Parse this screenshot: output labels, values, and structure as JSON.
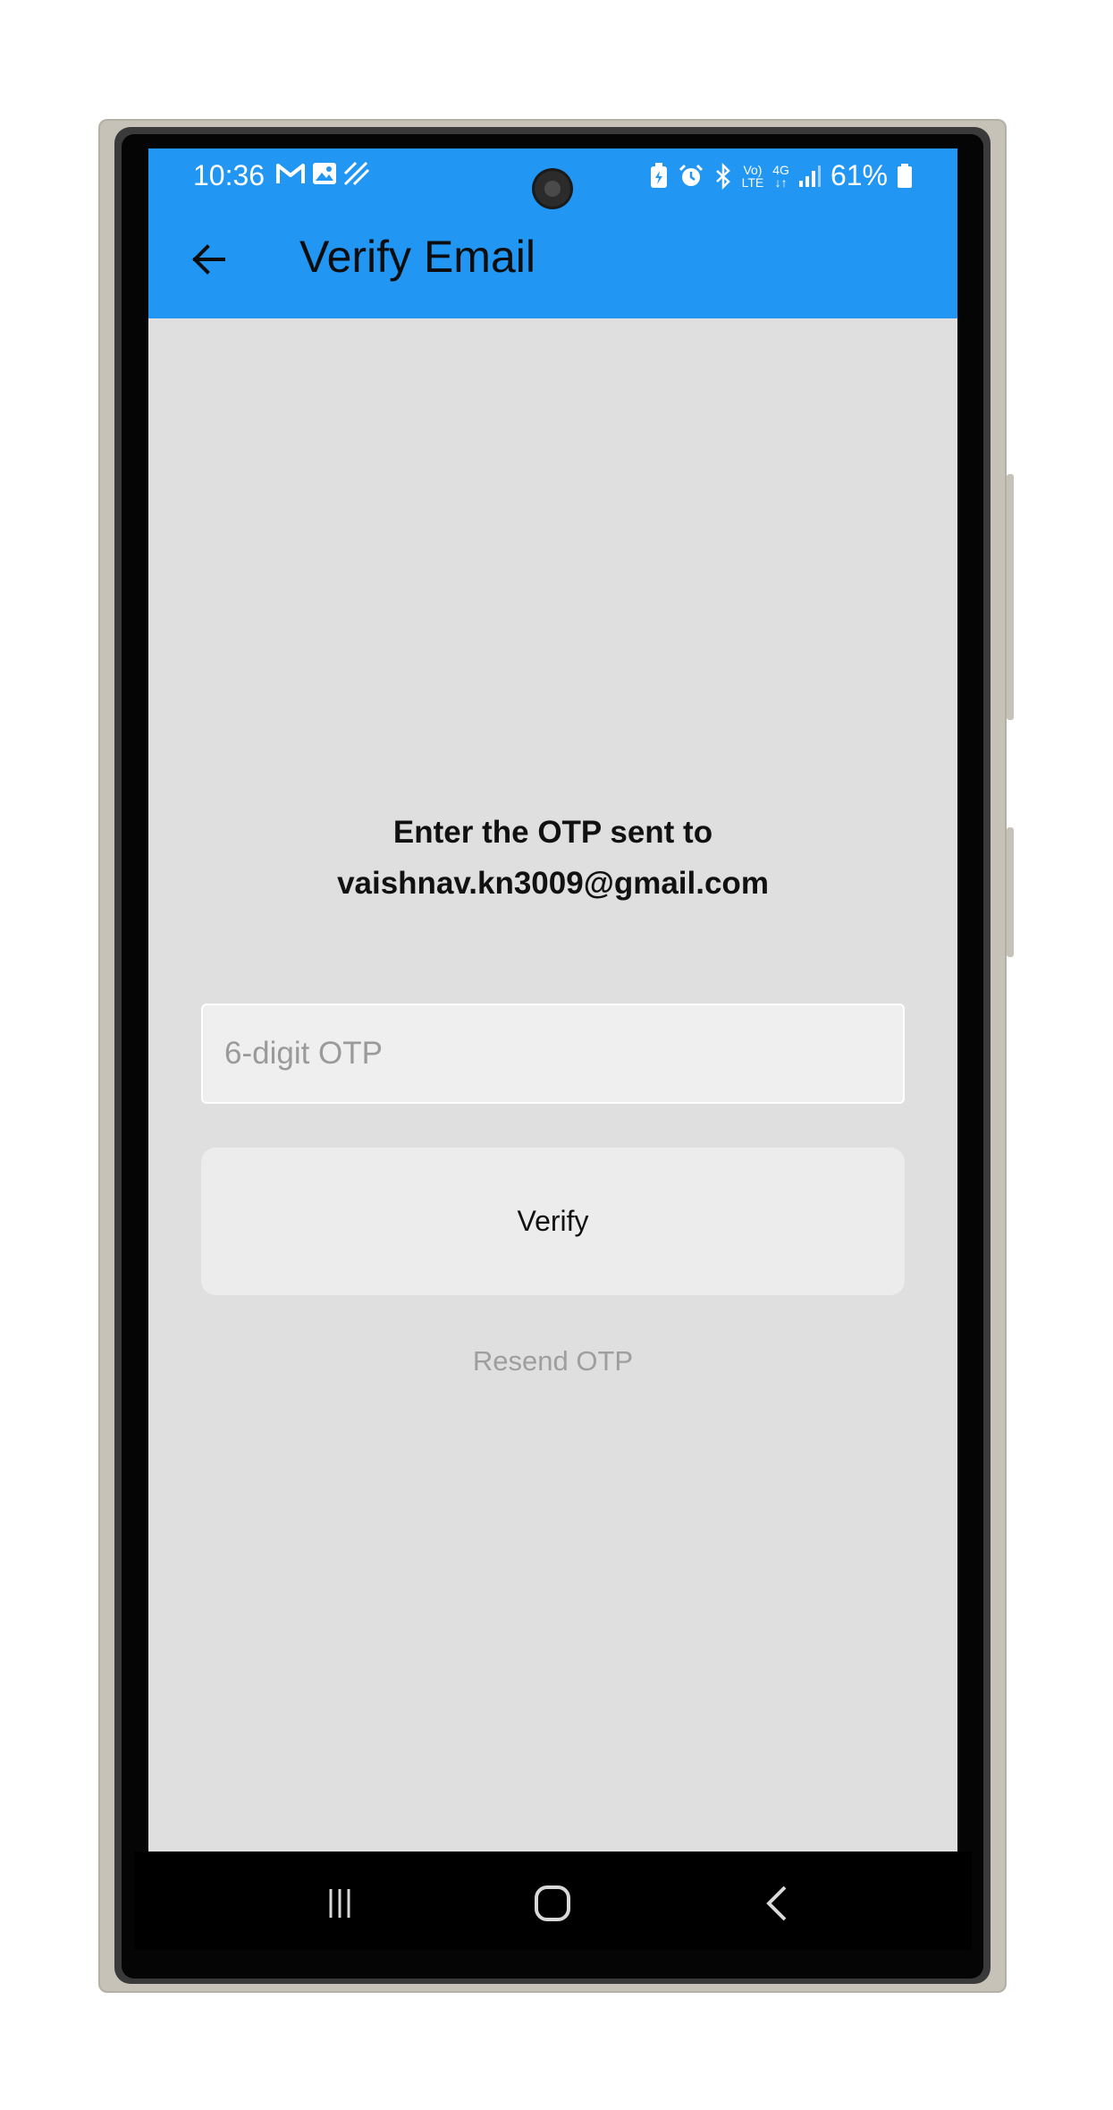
{
  "status_bar": {
    "time": "10:36",
    "battery": "61%",
    "left_icons": [
      "gmail-icon",
      "gallery-icon",
      "sync-stripes-icon"
    ],
    "right_icons": [
      "battery-saver-icon",
      "alarm-icon",
      "bluetooth-icon",
      "volte-icon",
      "4g-icon",
      "signal-icon",
      "battery-icon"
    ],
    "volte_top": "Vo)",
    "volte_bottom": "LTE",
    "net_top": "4G",
    "net_bottom": "↓↑"
  },
  "app_bar": {
    "title": "Verify Email",
    "back_icon": "back-arrow-icon",
    "color": "#2196f3"
  },
  "main": {
    "prompt_line1": "Enter the OTP sent to",
    "prompt_line2": "vaishnav.kn3009@gmail.com",
    "otp_placeholder": "6-digit OTP",
    "otp_value": "",
    "verify_label": "Verify",
    "resend_label": "Resend OTP"
  },
  "nav_bar": {
    "items": [
      "recents-icon",
      "home-icon",
      "back-icon"
    ]
  }
}
